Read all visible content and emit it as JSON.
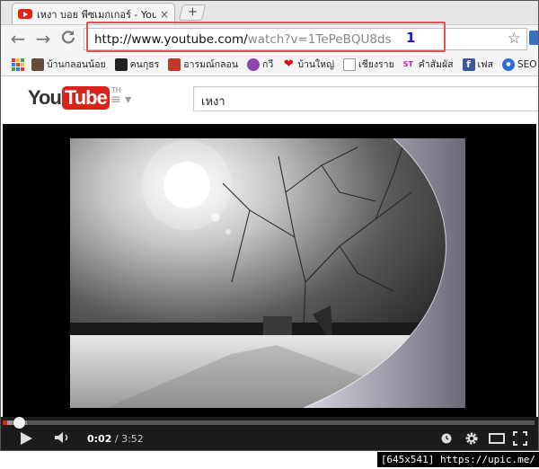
{
  "browser": {
    "tab_title": "เหงา บอย พีซเมกเกอร์ - You",
    "tab_close": "×",
    "new_tab": "+",
    "url_host": "http://www.youtube.com/",
    "url_path": "watch?v=1TePeBQU8ds",
    "annotation_number": "1",
    "nav_back": "←",
    "nav_forward": "→",
    "nav_reload": "C",
    "star": "☆"
  },
  "bookmarks": [
    {
      "label": "บ้านกลอนน้อย",
      "icon": "bookmark-favicon"
    },
    {
      "label": "คนกุธร",
      "icon": "bookmark-favicon"
    },
    {
      "label": "อารมณ์กลอน",
      "icon": "bookmark-favicon"
    },
    {
      "label": "กวี",
      "icon": "bookmark-favicon"
    },
    {
      "label": "บ้านใหญ่",
      "icon": "heart-icon"
    },
    {
      "label": "เชียงราย",
      "icon": "page-icon"
    },
    {
      "label": "คำสัมผัส",
      "icon": "st-icon"
    },
    {
      "label": "เฟส",
      "icon": "facebook-icon"
    },
    {
      "label": "SEO",
      "icon": "seo-icon"
    }
  ],
  "youtube": {
    "logo_you": "You",
    "logo_tube": "Tube",
    "logo_region": "TH",
    "guide_icon": "≡ ▾",
    "search_value": "เหงา"
  },
  "player": {
    "current_time": "0:02",
    "duration": "/ 3:52",
    "progress_fraction": 0.009,
    "buffered_fraction": 0.045,
    "colors": {
      "progress": "#e62117",
      "buffer": "#999999"
    }
  },
  "watermark": "[645x541] https://upic.me/"
}
